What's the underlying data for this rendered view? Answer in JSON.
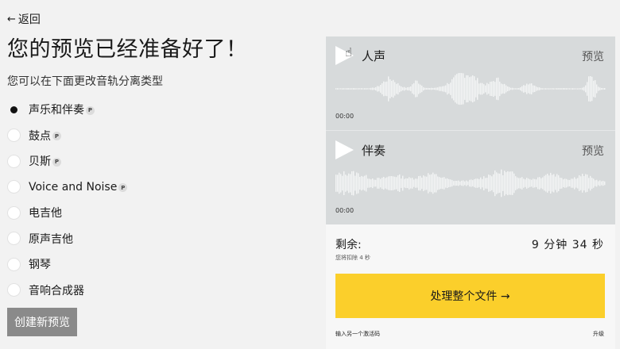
{
  "nav": {
    "back_label": "返回"
  },
  "heading": {
    "title": "您的预览已经准备好了！",
    "subtitle": "您可以在下面更改音轨分离类型"
  },
  "options": [
    {
      "label": "声乐和伴奏",
      "premium": true,
      "selected": true
    },
    {
      "label": "鼓点",
      "premium": true,
      "selected": false
    },
    {
      "label": "贝斯",
      "premium": true,
      "selected": false
    },
    {
      "label": "Voice and Noise",
      "premium": true,
      "selected": false
    },
    {
      "label": "电吉他",
      "premium": false,
      "selected": false
    },
    {
      "label": "原声吉他",
      "premium": false,
      "selected": false
    },
    {
      "label": "钢琴",
      "premium": false,
      "selected": false
    },
    {
      "label": "音响合成器",
      "premium": false,
      "selected": false
    }
  ],
  "premium_badge": "P",
  "create_button": "创建新预览",
  "tracks": [
    {
      "name": "人声",
      "preview_label": "预览",
      "time": "00:00",
      "icon": "play-icon"
    },
    {
      "name": "伴奏",
      "preview_label": "预览",
      "time": "00:00",
      "icon": "play-icon"
    }
  ],
  "remaining": {
    "label": "剩余:",
    "sub": "您将扣除 4 秒",
    "value": "9 分钟 34 秒"
  },
  "process_button": "处理整个文件 →",
  "footer": {
    "activation_link": "输入另一个激活码",
    "upgrade_link": "升级"
  },
  "colors": {
    "accent": "#fbcf2b",
    "track_bg": "#d7dadb",
    "wave": "#f4f5f5",
    "create_button": "#8a8a8a"
  }
}
